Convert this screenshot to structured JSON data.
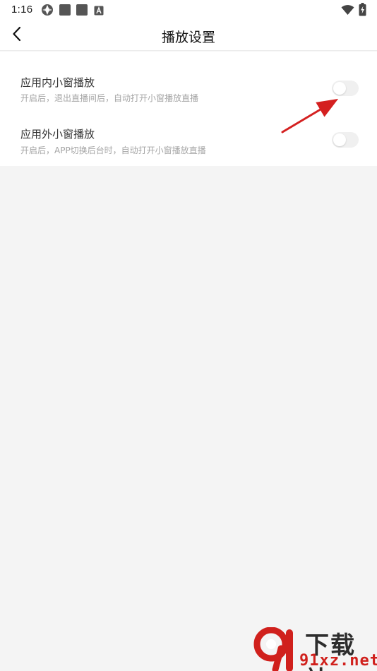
{
  "status_bar": {
    "time": "1:16",
    "left_icons": [
      "aperture-icon",
      "app-square-icon",
      "app-square-icon",
      "letter-a-icon"
    ],
    "right_icons": [
      "wifi-icon",
      "battery-charging-icon"
    ]
  },
  "header": {
    "title": "播放设置",
    "back_icon": "chevron-left-icon"
  },
  "settings": [
    {
      "title": "应用内小窗播放",
      "description": "开启后，退出直播间后，自动打开小窗播放直播",
      "enabled": false
    },
    {
      "title": "应用外小窗播放",
      "description": "开启后，APP切换后台时，自动打开小窗播放直播",
      "enabled": false
    }
  ],
  "annotation": {
    "type": "red-arrow",
    "color": "#d42020"
  },
  "watermark": {
    "logo_text": "下载站",
    "url": "91xz.net",
    "brand_colors": [
      "#d0201c",
      "#2d2d2d"
    ]
  }
}
